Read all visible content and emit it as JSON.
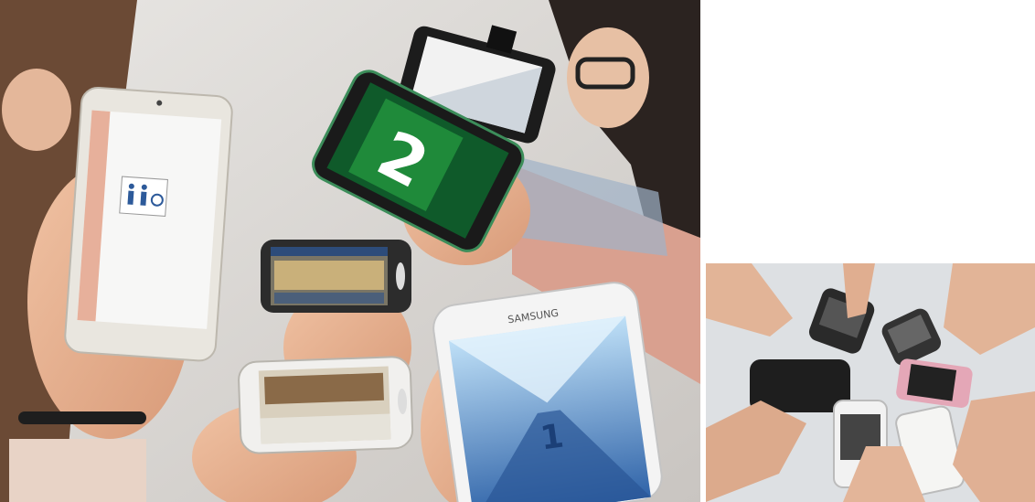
{
  "photos": [
    {
      "screen_texts": [
        "2",
        "1"
      ],
      "phone_brand": "SAMSUNG"
    },
    {
      "phone_brand": ""
    }
  ],
  "colors": {
    "wall": "#d7d4d1",
    "table": "#d9dde1",
    "green_sign": "#1f8a3a",
    "pink_phone": "#e4a7b7",
    "corridor_blue": "#2f63a8"
  }
}
